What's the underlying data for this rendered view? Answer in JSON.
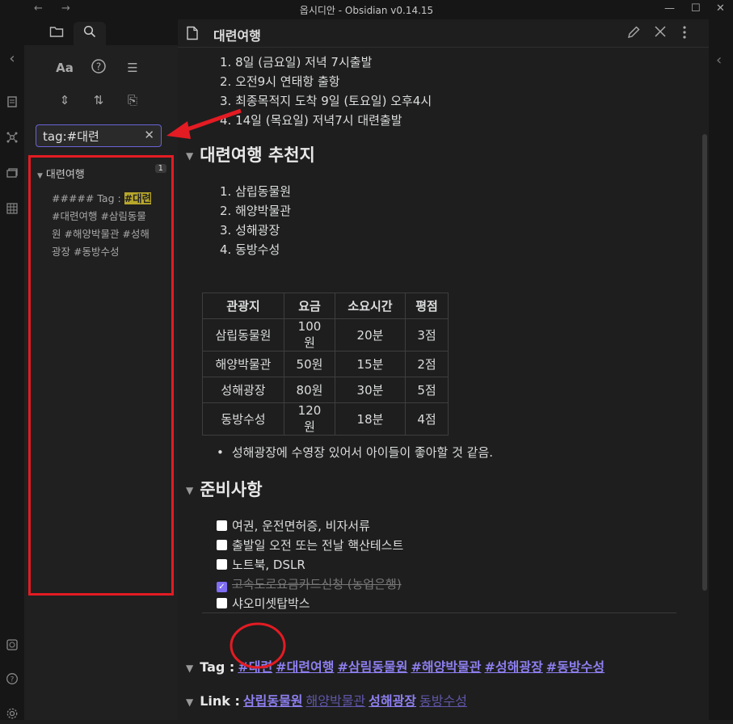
{
  "window": {
    "title": "옵시디안 - Obsidian v0.14.15",
    "back_glyph": "←",
    "forward_glyph": "→",
    "minimize_glyph": "—",
    "maximize_glyph": "☐",
    "close_glyph": "✕"
  },
  "ribbon": {
    "collapse_glyph": "‹",
    "icons": [
      "note-icon",
      "graph-icon",
      "cards-icon",
      "grid-icon",
      "vault-icon",
      "help-icon",
      "settings-icon"
    ]
  },
  "sidebar": {
    "tabs": [
      "file-explorer-icon",
      "search-icon"
    ],
    "tools": {
      "match_case": "Aa",
      "help": "?",
      "list": "☰",
      "expand": "⇕",
      "sort": "⇅",
      "copy": "⎘"
    },
    "search": {
      "value": "tag:#대련",
      "clear_glyph": "✕"
    },
    "result": {
      "file": "대련여행",
      "count": "1",
      "snippet_pre": "##### Tag : ",
      "snippet_match": "#대련",
      "snippet_post": " #대련여행 #삼림동물원 #해양박물관 #성해광장 #동방수성"
    }
  },
  "editor": {
    "title": "대련여행",
    "top_list": [
      "1. 8일 (금요일) 저녁 7시출발",
      "2. 오전9시 연태항 출항",
      "3. 최종목적지 도착 9일 (토요일) 오후4시",
      "4. 14일 (목요일) 저녁7시 대련출발"
    ],
    "section1": {
      "heading": "대련여행 추천지",
      "list": [
        "1. 삼립동물원",
        "2. 해양박물관",
        "3. 성해광장",
        "4. 동방수성"
      ]
    },
    "table": {
      "headers": [
        "관광지",
        "요금",
        "소요시간",
        "평점"
      ],
      "rows": [
        [
          "삼립동물원",
          "100원",
          "20분",
          "3점"
        ],
        [
          "해양박물관",
          "50원",
          "15분",
          "2점"
        ],
        [
          "성해광장",
          "80원",
          "30분",
          "5점"
        ],
        [
          "동방수성",
          "120원",
          "18분",
          "4점"
        ]
      ]
    },
    "bullet": "성해광장에 수영장 있어서 아이들이 좋아할 것 같음.",
    "section2": {
      "heading": "준비사항",
      "tasks": [
        {
          "label": "여권, 운전면허증, 비자서류",
          "done": false
        },
        {
          "label": "출발일 오전 또는 전날 핵산테스트",
          "done": false
        },
        {
          "label": "노트북, DSLR",
          "done": false
        },
        {
          "label": "고속도로요금카드신청 (농업은행)",
          "done": true
        },
        {
          "label": "샤오미셋탑박스",
          "done": false
        }
      ]
    },
    "tag_line": {
      "label": "Tag :",
      "tags": [
        "#대련",
        "#대련여행",
        "#삼림동물원",
        "#해양박물관",
        "#성해광장",
        "#동방수성"
      ]
    },
    "link_line": {
      "label": "Link :",
      "links": [
        "삼립동물원",
        "해양박물관",
        "성해광장",
        "동방수성"
      ]
    }
  },
  "annotation_color": "#e31b23",
  "accent_color": "#7f6df2"
}
